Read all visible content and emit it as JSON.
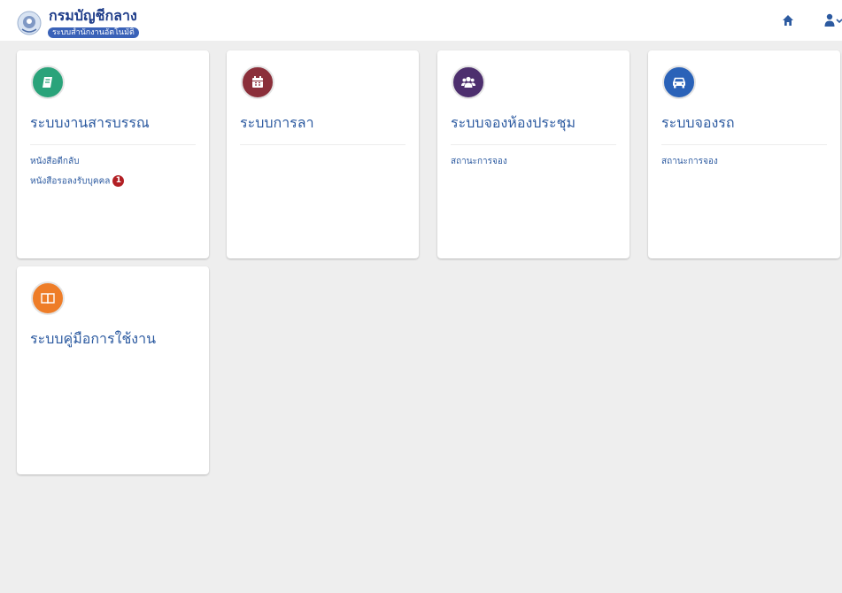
{
  "header": {
    "title": "กรมบัญชีกลาง",
    "subtitle": "ระบบสำนักงานอัตโนมัติ"
  },
  "colors": {
    "accent": "#2c5aa0",
    "badge": "#b21f24"
  },
  "cards": [
    {
      "title": "ระบบงานสารบรรณ",
      "icon": "book-icon",
      "icon_color": "#2aa37a",
      "links": [
        {
          "label": "หนังสือตีกลับ"
        },
        {
          "label": "หนังสือรอลงรับบุคคล",
          "badge": "1"
        }
      ]
    },
    {
      "title": "ระบบการลา",
      "icon": "calendar-icon",
      "icon_color": "#8b2f3a",
      "links": []
    },
    {
      "title": "ระบบจองห้องประชุม",
      "icon": "users-icon",
      "icon_color": "#4d2f6e",
      "links": [
        {
          "label": "สถานะการจอง"
        }
      ]
    },
    {
      "title": "ระบบจองรถ",
      "icon": "car-icon",
      "icon_color": "#2a62b8",
      "links": [
        {
          "label": "สถานะการจอง"
        }
      ]
    },
    {
      "title": "ระบบคู่มือการใช้งาน",
      "icon": "open-book-icon",
      "icon_color": "#ee7d28",
      "links": []
    }
  ]
}
